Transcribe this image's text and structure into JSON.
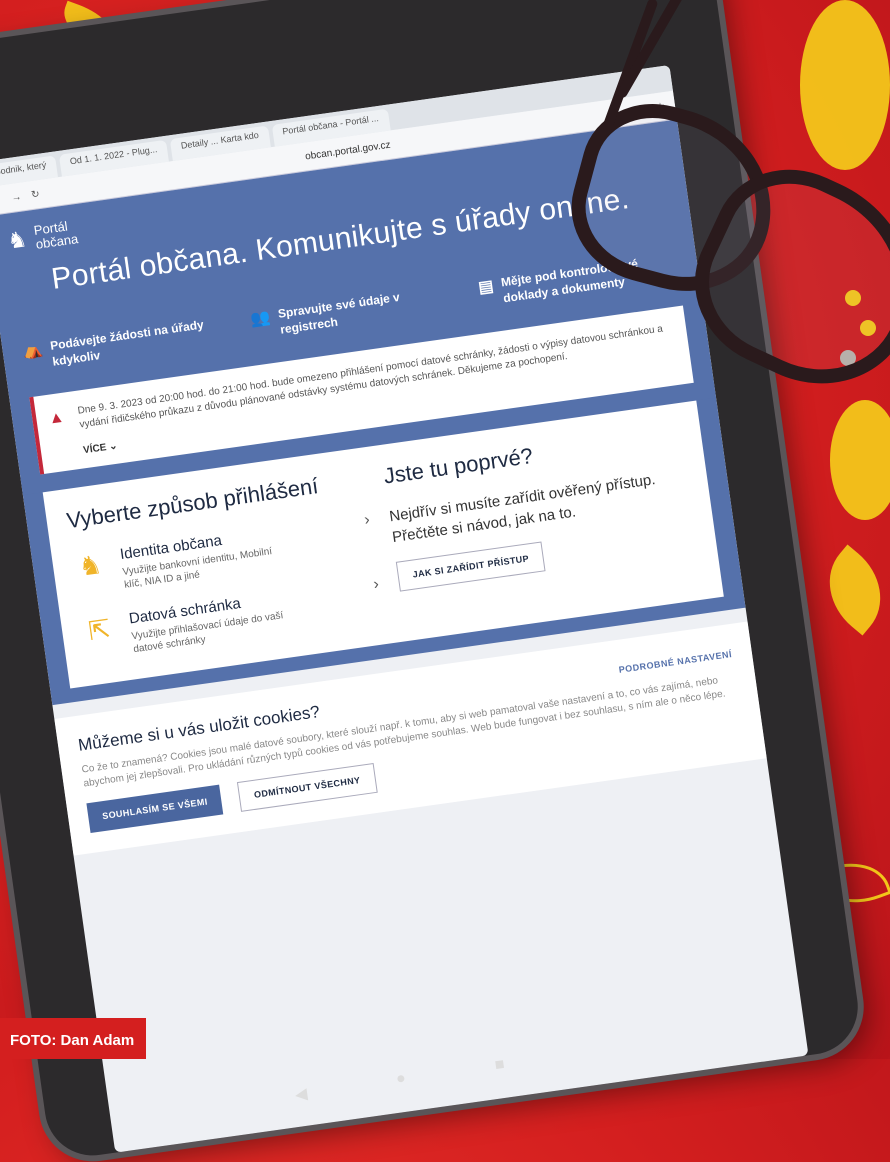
{
  "browser": {
    "tabs": [
      "podnik, který",
      "Od 1. 1. 2022 - Plug...",
      "Detaily ... Karta kdo",
      "Portál občana - Portál ..."
    ],
    "url": "obcan.portal.gov.cz"
  },
  "hero": {
    "logo_line1": "Portál",
    "logo_line2": "občana",
    "title": "Portál občana. Komunikujte s úřady online.",
    "features": [
      {
        "icon": "tent-icon",
        "label": "Podávejte žádosti na úřady kdykoliv"
      },
      {
        "icon": "people-icon",
        "label": "Spravujte své údaje v registrech"
      },
      {
        "icon": "document-icon",
        "label": "Mějte pod kontrolou své doklady a dokumenty"
      }
    ]
  },
  "alert": {
    "text": "Dne 9. 3. 2023 od 20:00 hod. do 21:00 hod. bude omezeno přihlášení pomocí datové schránky, žádosti o výpisy datovou schránkou a vydání řidičského průkazu z důvodu plánované odstávky systému datových schránek. Děkujeme za pochopení.",
    "more": "VÍCE"
  },
  "login": {
    "heading": "Vyberte způsob přihlášení",
    "options": [
      {
        "title": "Identita občana",
        "desc": "Využijte bankovní identitu, Mobilní klíč, NIA ID a jiné"
      },
      {
        "title": "Datová schránka",
        "desc": "Využijte přihlašovací údaje do vaší datové schránky"
      }
    ]
  },
  "first_time": {
    "heading": "Jste tu poprvé?",
    "text": "Nejdřív si musíte zařídit ověřený přístup. Přečtěte si návod, jak na to.",
    "button": "JAK SI ZAŘÍDIT PŘÍSTUP"
  },
  "cookies": {
    "heading": "Můžeme si u vás uložit cookies?",
    "settings_link": "PODROBNÉ NASTAVENÍ",
    "text": "Co že to znamená? Cookies jsou malé datové soubory, které slouží např. k tomu, aby si web pamatoval vaše nastavení a to, co vás zajímá, nebo abychom jej zlepšovali. Pro ukládání různých typů cookies od vás potřebujeme souhlas. Web bude fungovat i bez souhlasu, s ním ale o něco lépe.",
    "accept": "SOUHLASÍM SE VŠEMI",
    "reject": "ODMÍTNOUT VŠECHNY"
  },
  "credit": "FOTO: Dan Adam"
}
